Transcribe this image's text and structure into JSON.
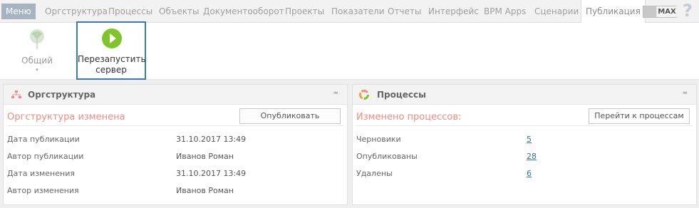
{
  "menubar": {
    "menu_label": "Меню",
    "tabs": [
      {
        "label": "Оргструктура"
      },
      {
        "label": "Процессы"
      },
      {
        "label": "Объекты"
      },
      {
        "label": "Документооборот"
      },
      {
        "label": "Проекты"
      },
      {
        "label": "Показатели"
      },
      {
        "label": "Отчеты"
      },
      {
        "label": "Интерфейс"
      },
      {
        "label": "BPM Apps"
      },
      {
        "label": "Сценарии"
      },
      {
        "label": "Публикация"
      }
    ],
    "active_tab": "Публикация",
    "max_label": "MAX",
    "help_glyph": "?"
  },
  "ribbon": {
    "general_label": "Общий",
    "general_caret": "▾",
    "restart_label": "Перезапустить сервер"
  },
  "org_panel": {
    "title": "Оргструктура",
    "collapse_glyph": "≈",
    "status": "Оргструктура изменена",
    "publish_button": "Опубликовать",
    "rows": [
      {
        "label": "Дата публикации",
        "value": "31.10.2017 13:49"
      },
      {
        "label": "Автор публикации",
        "value": "Иванов Роман"
      },
      {
        "label": "Дата изменения",
        "value": "31.10.2017 13:49"
      },
      {
        "label": "Автор изменения",
        "value": "Иванов Роман"
      }
    ]
  },
  "process_panel": {
    "title": "Процессы",
    "collapse_glyph": "≈",
    "status": "Изменено процессов:",
    "goto_button": "Перейти к процессам",
    "rows": [
      {
        "label": "Черновики",
        "value": "5"
      },
      {
        "label": "Опубликованы",
        "value": "28"
      },
      {
        "label": "Удалены",
        "value": "6"
      }
    ]
  },
  "colors": {
    "status_text": "#f08b82",
    "play_icon": "#7ec52c",
    "highlight_border": "#3a7ab3",
    "link": "#2f6fb5"
  }
}
